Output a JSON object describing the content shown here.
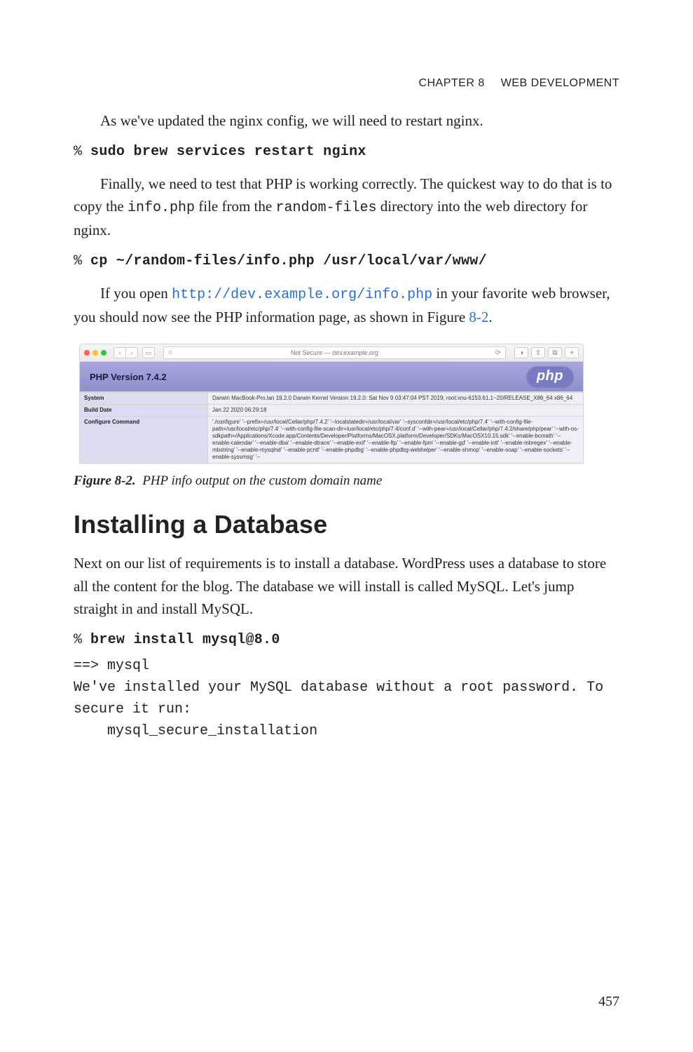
{
  "header": {
    "chapter": "CHAPTER 8",
    "title": "WEB DEVELOPMENT"
  },
  "p1": "As we've updated the nginx config, we will need to restart nginx.",
  "cmd1_prompt": "% ",
  "cmd1": "sudo brew services restart nginx",
  "p2a": "Finally, we need to test that PHP is working correctly. The quickest way to do that is to copy the ",
  "p2_code1": "info.php",
  "p2b": " file from the ",
  "p2_code2": "random-files",
  "p2c": " directory into the web directory for nginx.",
  "cmd2_prompt": "% ",
  "cmd2": "cp ~/random-files/info.php /usr/local/var/www/",
  "p3a": "If you open ",
  "p3_url": "http://dev.example.org/info.php",
  "p3b": " in your favorite web browser, you should now see the PHP information page, as shown in Figure ",
  "p3_figref": "8-2",
  "p3c": ".",
  "figure": {
    "url_label": "Not Secure — dev.example.org",
    "php_title": "PHP Version 7.4.2",
    "php_logo": "php",
    "rows": [
      {
        "k": "System",
        "v": "Darwin MacBook-Pro.lan 19.2.0 Darwin Kernel Version 19.2.0: Sat Nov 9 03:47:04 PST 2019; root:xnu-6153.61.1~20/RELEASE_X86_64 x86_64"
      },
      {
        "k": "Build Date",
        "v": "Jan 22 2020 06:29:18"
      },
      {
        "k": "Configure Command",
        "v": "'./configure' '--prefix=/usr/local/Cellar/php/7.4.2' '--localstatedir=/usr/local/var' '--sysconfdir=/usr/local/etc/php/7.4' '--with-config-file-path=/usr/local/etc/php/7.4' '--with-config-file-scan-dir=/usr/local/etc/php/7.4/conf.d' '--with-pear=/usr/local/Cellar/php/7.4.2/share/php/pear' '--with-os-sdkpath=/Applications/Xcode.app/Contents/Developer/Platforms/MacOSX.platform/Developer/SDKs/MacOSX10.15.sdk' '--enable-bcmath' '--enable-calendar' '--enable-dba' '--enable-dtrace' '--enable-exif' '--enable-ftp' '--enable-fpm' '--enable-gd' '--enable-intl' '--enable-mbregex' '--enable-mbstring' '--enable-mysqlnd' '--enable-pcntl' '--enable-phpdbg' '--enable-phpdbg-webhelper' '--enable-shmop' '--enable-soap' '--enable-sockets' '--enable-sysvmsg' '--"
      }
    ]
  },
  "caption_label": "Figure 8-2.",
  "caption_text": "PHP info output on the custom domain name",
  "section_heading": "Installing a Database",
  "p4": "Next on our list of requirements is to install a database. WordPress uses a database to store all the content for the blog. The database we will install is called MySQL. Let's jump straight in and install MySQL.",
  "cmd3_prompt": "% ",
  "cmd3": "brew install mysql@8.0",
  "output3": "==> mysql\nWe've installed your MySQL database without a root password. To secure it run:\n    mysql_secure_installation",
  "page_number": "457"
}
